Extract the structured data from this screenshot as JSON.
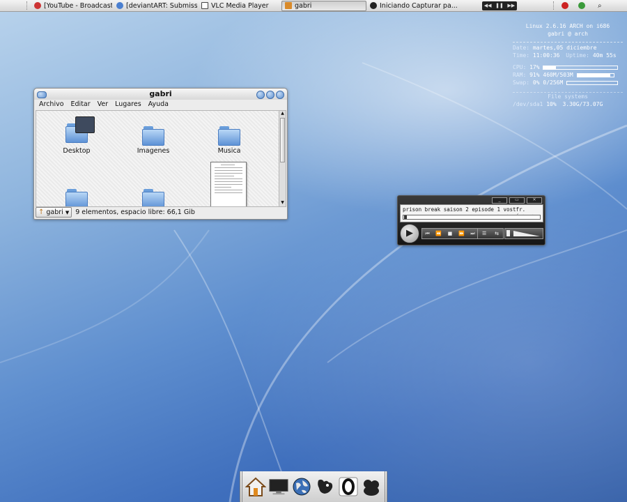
{
  "top_panel": {
    "tasks": [
      {
        "label": "[YouTube - Broadcast...",
        "icon": "headphones-icon"
      },
      {
        "label": "[deviantART: Submiss...",
        "icon": "globe-icon"
      },
      {
        "label": "VLC Media Player",
        "icon": "window-icon"
      },
      {
        "label": "gabri",
        "icon": "home-arrow-icon",
        "active": true
      },
      {
        "label": "Iniciando Capturar pa...",
        "icon": "camera-icon"
      }
    ],
    "media_controls": [
      "◀◀",
      "❚❚",
      "▶▶"
    ],
    "search_icon": "⌕"
  },
  "conky": {
    "system": "Linux 2.6.16 ARCH on i686",
    "user_host": "gabri @ arch",
    "date_label": "Date:",
    "date_value": "martes,05 diciembre",
    "time_label": "Time:",
    "time_value": "11:00:36",
    "uptime_label": "Uptime:",
    "uptime_value": "40m 55s",
    "cpu_label": "CPU:",
    "cpu_value": "17%",
    "cpu_usage": 0.17,
    "ram_label": "RAM:",
    "ram_value": "91%",
    "ram_detail": "460M/503M",
    "ram_usage": 0.91,
    "swap_label": "Swap:",
    "swap_value": "0%",
    "swap_detail": "0/256M",
    "swap_usage": 0.0,
    "fs_header": "File systems",
    "fs_device": "/dev/sda1",
    "fs_percent": "10%",
    "fs_detail": "3.30G/73.07G"
  },
  "file_manager": {
    "title": "gabri",
    "menu": [
      "Archivo",
      "Editar",
      "Ver",
      "Lugares",
      "Ayuda"
    ],
    "items": [
      {
        "label": "Desktop"
      },
      {
        "label": "Imagenes"
      },
      {
        "label": "Musica"
      }
    ],
    "location_label": "gabri",
    "status": "9 elementos, espacio libre: 66,1 Gib"
  },
  "media_player": {
    "window_controls": [
      "_",
      "▭",
      "✕"
    ],
    "now_playing": "prison break saison 2 episode 1 vostfr.",
    "time_display": "-:--:--/-:--:--",
    "play_symbol": "▶",
    "nav_buttons": [
      "⏮",
      "⏪",
      "■",
      "⏩",
      "⏭"
    ],
    "playlist_symbol": "☰",
    "extra_symbol": "⇆"
  },
  "dock": {
    "items": [
      "home-icon",
      "monitor-icon",
      "globe-icon",
      "gimp-icon",
      "opera-icon",
      "amsn-icon"
    ]
  },
  "colors": {
    "desktop_top": "#b9d3ec",
    "desktop_bottom": "#3560a8",
    "folder_blue": "#5e92d6"
  }
}
